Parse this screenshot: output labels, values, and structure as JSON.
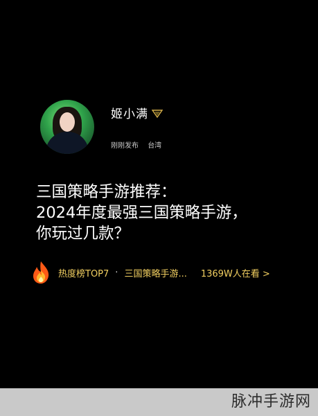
{
  "post": {
    "username": "姬小满",
    "badge_icon": "vip-badge-icon",
    "published": "刚刚发布",
    "location": "台湾",
    "title_lines": [
      "三国策略手游推荐：",
      "2024年度最强三国策略手游，",
      "你玩过几款？"
    ]
  },
  "hot": {
    "icon": "fire-icon",
    "rank": "热度榜TOP7",
    "separator": "·",
    "topic": "三国策略手游...",
    "views": "1369W人在看 >"
  },
  "watermark": {
    "text": "脉冲手游网"
  },
  "colors": {
    "background": "#000000",
    "hot_text": "#f3d061",
    "footer": "#c9c9c9"
  }
}
